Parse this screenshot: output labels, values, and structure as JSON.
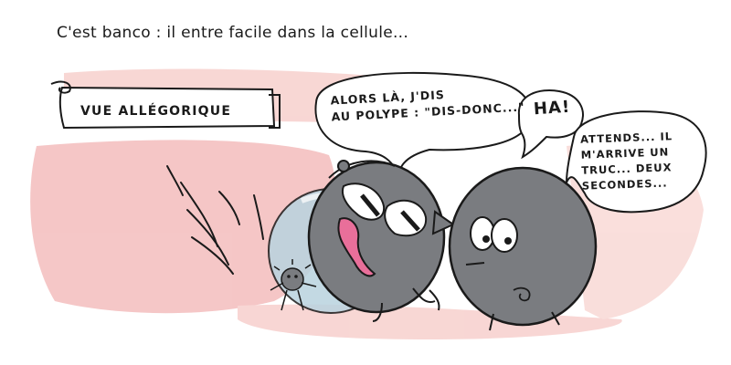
{
  "caption": "C'est banco : il entre facile dans la cellule...",
  "banner": {
    "label": "VUE ALLÉGORIQUE"
  },
  "bubbles": {
    "polyp_speech": [
      "ALORS LÀ, J'DIS",
      "AU POLYPE : \"DIS-DONC...\""
    ],
    "exclamation": "HA!",
    "cell_speech": [
      "ATTENDS... IL",
      "M'ARRIVE UN",
      "TRUC... DEUX",
      "SECONDES..."
    ]
  },
  "colors": {
    "wash_pink": "#f2b4b4",
    "ink": "#1a1a1a",
    "creature_gray": "#7a7c80",
    "bubble_blue": "#b9d3df"
  }
}
